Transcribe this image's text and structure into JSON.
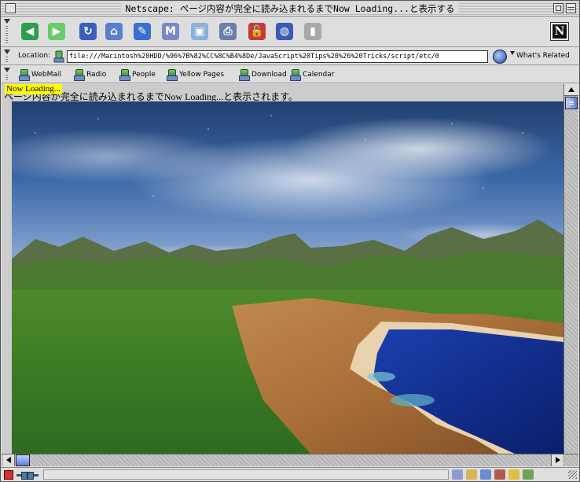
{
  "window": {
    "title": "Netscape: ページ内容が完全に読み込まれるまでNow Loading...と表示する"
  },
  "navigation_toolbar": {
    "buttons": [
      {
        "name": "back",
        "icon": "back-arrow-icon",
        "color": "#2e9e4e"
      },
      {
        "name": "forward",
        "icon": "forward-arrow-icon",
        "color": "#6acb6a"
      },
      {
        "name": "reload",
        "icon": "reload-icon",
        "color": "#3a5fbf"
      },
      {
        "name": "home",
        "icon": "home-icon",
        "color": "#5b7fd0"
      },
      {
        "name": "search",
        "icon": "search-icon",
        "color": "#3b6fcf"
      },
      {
        "name": "my-netscape",
        "icon": "my-netscape-icon",
        "color": "#7b88c8"
      },
      {
        "name": "images",
        "icon": "images-icon",
        "color": "#8cb0d8"
      },
      {
        "name": "print",
        "icon": "print-icon",
        "color": "#6b7fae"
      },
      {
        "name": "security",
        "icon": "security-lock-icon",
        "color": "#c53a3a"
      },
      {
        "name": "shop",
        "icon": "shop-icon",
        "color": "#3b5bb0"
      },
      {
        "name": "stop",
        "icon": "stop-icon",
        "color": "#a9a9a9"
      }
    ],
    "logo_letter": "N"
  },
  "location_bar": {
    "label": "Location:",
    "url": "file:///Macintosh%20HDD/%96%7B%82%CC%8C%B4%8De/JavaScript%20Tips%20%26%20Tricks/script/etc/0",
    "whats_related_label": "What's Related"
  },
  "personal_toolbar": {
    "items": [
      "WebMail",
      "Radio",
      "People",
      "Yellow Pages",
      "Download",
      "Calendar"
    ]
  },
  "content": {
    "loading_label": "Now Loading...",
    "status_text": "ページ内容が完全に読み込まれるまでNow Loading...と表示されます。"
  },
  "colors": {
    "loading_highlight": "#ffff00",
    "chrome": "#dedede",
    "scroll_thumb": "#5d7ed6"
  }
}
